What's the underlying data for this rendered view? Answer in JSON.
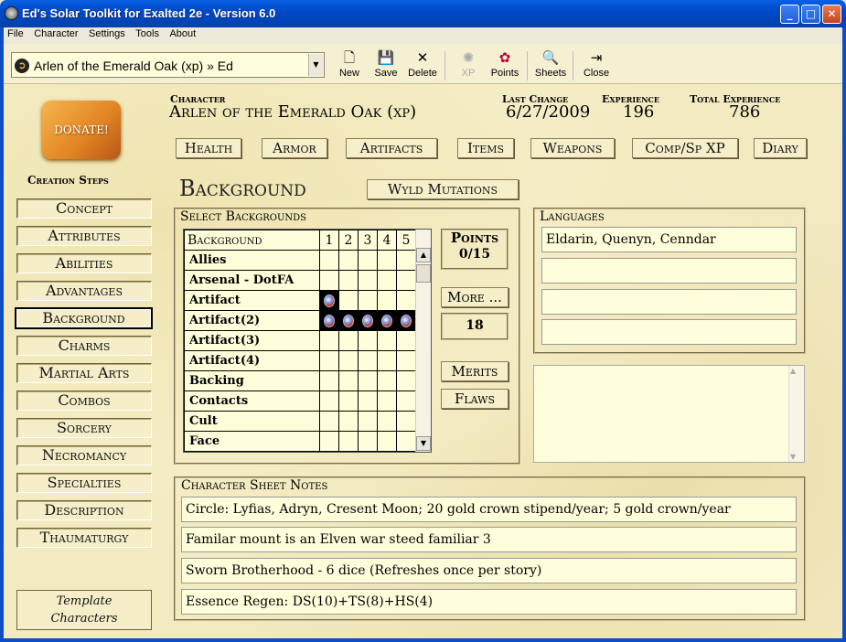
{
  "window": {
    "title": "Ed's Solar Toolkit for Exalted 2e - Version 6.0"
  },
  "menu": [
    "File",
    "Character",
    "Settings",
    "Tools",
    "About"
  ],
  "toolbar": {
    "character_select": "Arlen of the Emerald Oak (xp) » Ed",
    "buttons": [
      {
        "label": "New",
        "icon": "new-document-icon"
      },
      {
        "label": "Save",
        "icon": "floppy-disk-icon"
      },
      {
        "label": "Delete",
        "icon": "delete-x-icon"
      },
      {
        "label": "XP",
        "icon": "xp-icon",
        "disabled": true
      },
      {
        "label": "Points",
        "icon": "points-icon"
      },
      {
        "label": "Sheets",
        "icon": "sheets-icon"
      },
      {
        "label": "Close",
        "icon": "close-door-icon"
      }
    ]
  },
  "donate": "DONATE!",
  "creation_steps": {
    "heading": "Creation Steps",
    "items": [
      "Concept",
      "Attributes",
      "Abilities",
      "Advantages",
      "Background",
      "Charms",
      "Martial Arts",
      "Combos",
      "Sorcery",
      "Necromancy",
      "Specialties",
      "Description",
      "Thaumaturgy"
    ],
    "selected": "Background"
  },
  "template_button": {
    "line1": "Template",
    "line2": "Characters"
  },
  "header": {
    "character_label": "Character",
    "character_value": "Arlen of the Emerald Oak (xp)",
    "last_change_label": "Last Change",
    "last_change_value": "6/27/2009",
    "experience_label": "Experience",
    "experience_value": "196",
    "total_experience_label": "Total Experience",
    "total_experience_value": "786"
  },
  "tabs": [
    "Health",
    "Armor",
    "Artifacts",
    "Items",
    "Weapons",
    "Comp/Sp XP",
    "Diary"
  ],
  "section_title": "Background",
  "wyld_button": "Wyld Mutations",
  "backgrounds": {
    "title": "Select Backgrounds",
    "column_header": "Background",
    "dots": [
      "1",
      "2",
      "3",
      "4",
      "5"
    ],
    "rows": [
      {
        "name": "Allies",
        "level": 0
      },
      {
        "name": "Arsenal - DotFA",
        "level": 0
      },
      {
        "name": "Artifact",
        "level": 1
      },
      {
        "name": "Artifact(2)",
        "level": 5
      },
      {
        "name": "Artifact(3)",
        "level": 0
      },
      {
        "name": "Artifact(4)",
        "level": 0
      },
      {
        "name": "Backing",
        "level": 0
      },
      {
        "name": "Contacts",
        "level": 0
      },
      {
        "name": "Cult",
        "level": 0
      },
      {
        "name": "Face",
        "level": 0
      }
    ]
  },
  "points": {
    "label": "Points",
    "value": "0/15"
  },
  "more_button": "More ...",
  "more_value": "18",
  "merits_button": "Merits",
  "flaws_button": "Flaws",
  "languages": {
    "title": "Languages",
    "fields": [
      "Eldarin, Quenyn, Cenndar",
      "",
      "",
      ""
    ]
  },
  "notes": {
    "title": "Character Sheet Notes",
    "fields": [
      "Circle: Lyfias, Adryn, Cresent Moon; 20 gold crown stipend/year; 5 gold crown/year",
      "Familar mount is an Elven war steed familiar 3",
      "Sworn Brotherhood - 6 dice (Refreshes once per story)",
      "Essence Regen: DS(10)+TS(8)+HS(4)"
    ]
  }
}
